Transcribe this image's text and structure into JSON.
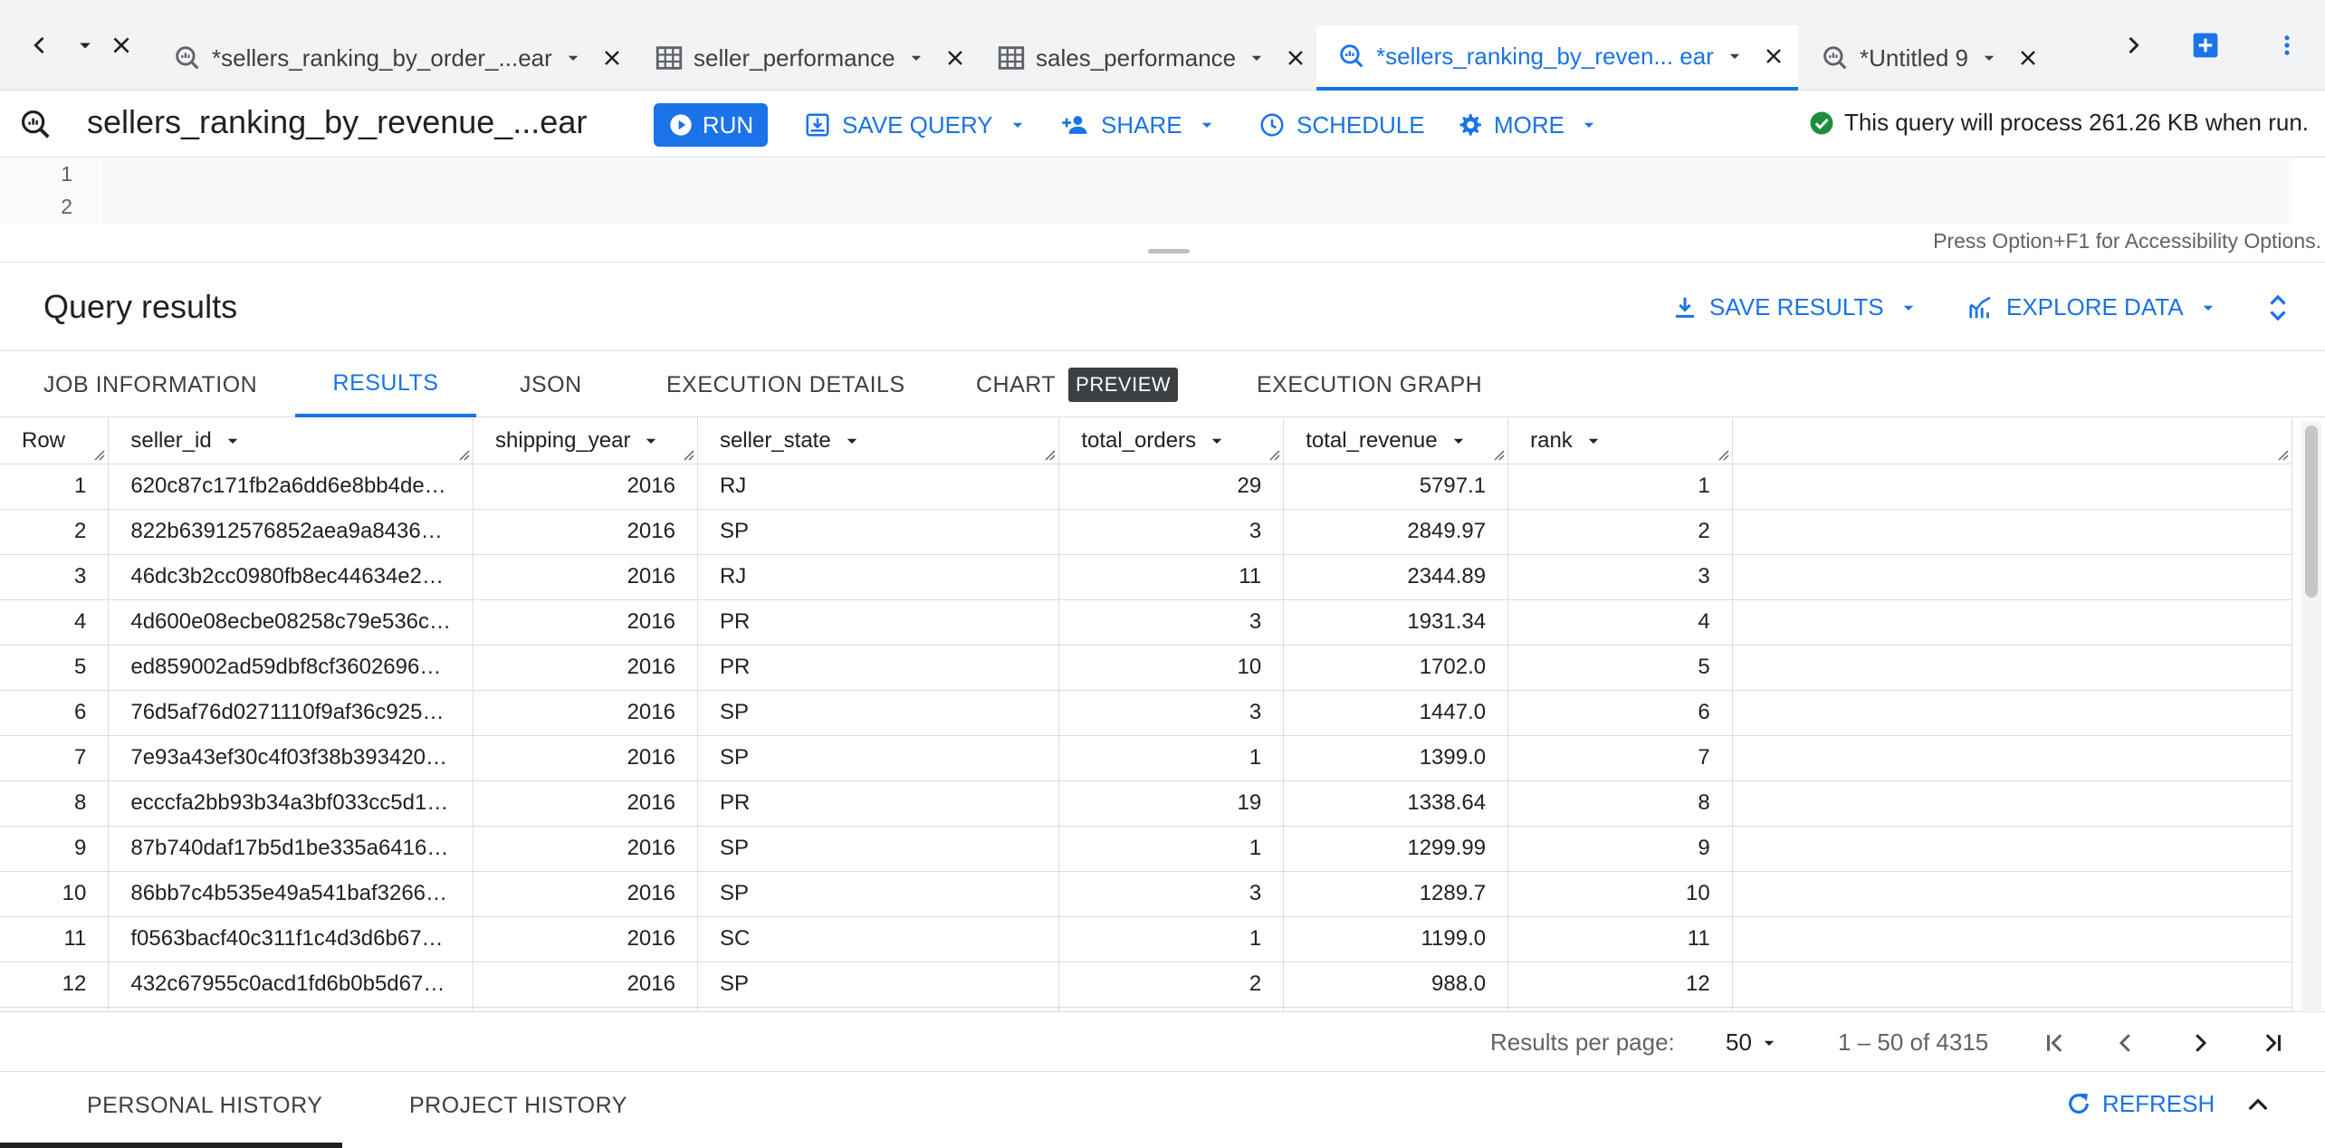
{
  "tabs": [
    {
      "title": "*sellers_ranking_by_order_...ear",
      "icon": "query-icon",
      "active": false
    },
    {
      "title": "seller_performance",
      "icon": "table-icon",
      "active": false
    },
    {
      "title": "sales_performance",
      "icon": "table-icon",
      "active": false
    },
    {
      "title": "*sellers_ranking_by_reven... ear",
      "icon": "query-icon",
      "active": true
    },
    {
      "title": "*Untitled 9",
      "icon": "query-icon",
      "active": false
    }
  ],
  "toolbar": {
    "query_title": "sellers_ranking_by_revenue_...ear",
    "run_label": "RUN",
    "save_query_label": "SAVE QUERY",
    "share_label": "SHARE",
    "schedule_label": "SCHEDULE",
    "more_label": "MORE",
    "status_text": "This query will process 261.26 KB when run."
  },
  "editor": {
    "line_numbers": [
      "1",
      "2"
    ],
    "a11y_hint": "Press Option+F1 for Accessibility Options."
  },
  "results": {
    "title": "Query results",
    "save_results_label": "SAVE RESULTS",
    "explore_data_label": "EXPLORE DATA",
    "tabs": {
      "job_information": "JOB INFORMATION",
      "results": "RESULTS",
      "json": "JSON",
      "execution_details": "EXECUTION DETAILS",
      "chart": "CHART",
      "preview_badge": "PREVIEW",
      "execution_graph": "EXECUTION GRAPH"
    },
    "columns": [
      "Row",
      "seller_id",
      "shipping_year",
      "seller_state",
      "total_orders",
      "total_revenue",
      "rank"
    ],
    "rows": [
      [
        "1",
        "620c87c171fb2a6dd6e8bb4de…",
        "2016",
        "RJ",
        "29",
        "5797.1",
        "1"
      ],
      [
        "2",
        "822b63912576852aea9a8436…",
        "2016",
        "SP",
        "3",
        "2849.97",
        "2"
      ],
      [
        "3",
        "46dc3b2cc0980fb8ec44634e2…",
        "2016",
        "RJ",
        "11",
        "2344.89",
        "3"
      ],
      [
        "4",
        "4d600e08ecbe08258c79e536c…",
        "2016",
        "PR",
        "3",
        "1931.34",
        "4"
      ],
      [
        "5",
        "ed859002ad59dbf8cf3602696…",
        "2016",
        "PR",
        "10",
        "1702.0",
        "5"
      ],
      [
        "6",
        "76d5af76d0271110f9af36c925…",
        "2016",
        "SP",
        "3",
        "1447.0",
        "6"
      ],
      [
        "7",
        "7e93a43ef30c4f03f38b393420…",
        "2016",
        "SP",
        "1",
        "1399.0",
        "7"
      ],
      [
        "8",
        "ecccfa2bb93b34a3bf033cc5d1…",
        "2016",
        "PR",
        "19",
        "1338.64",
        "8"
      ],
      [
        "9",
        "87b740daf17b5d1be335a6416…",
        "2016",
        "SP",
        "1",
        "1299.99",
        "9"
      ],
      [
        "10",
        "86bb7c4b535e49a541baf3266…",
        "2016",
        "SP",
        "3",
        "1289.7",
        "10"
      ],
      [
        "11",
        "f0563bacf40c311f1c4d3d6b67…",
        "2016",
        "SC",
        "1",
        "1199.0",
        "11"
      ],
      [
        "12",
        "432c67955c0acd1fd6b0b5d67…",
        "2016",
        "SP",
        "2",
        "988.0",
        "12"
      ]
    ],
    "pager": {
      "rpp_label": "Results per page:",
      "rpp_value": "50",
      "range_text": "1 – 50 of 4315"
    }
  },
  "history": {
    "personal": "PERSONAL HISTORY",
    "project": "PROJECT HISTORY",
    "refresh": "REFRESH"
  },
  "colors": {
    "accent": "#1a73e8",
    "success": "#1e8e3e",
    "text": "#202124",
    "muted": "#5f6368",
    "border": "#dadce0"
  }
}
